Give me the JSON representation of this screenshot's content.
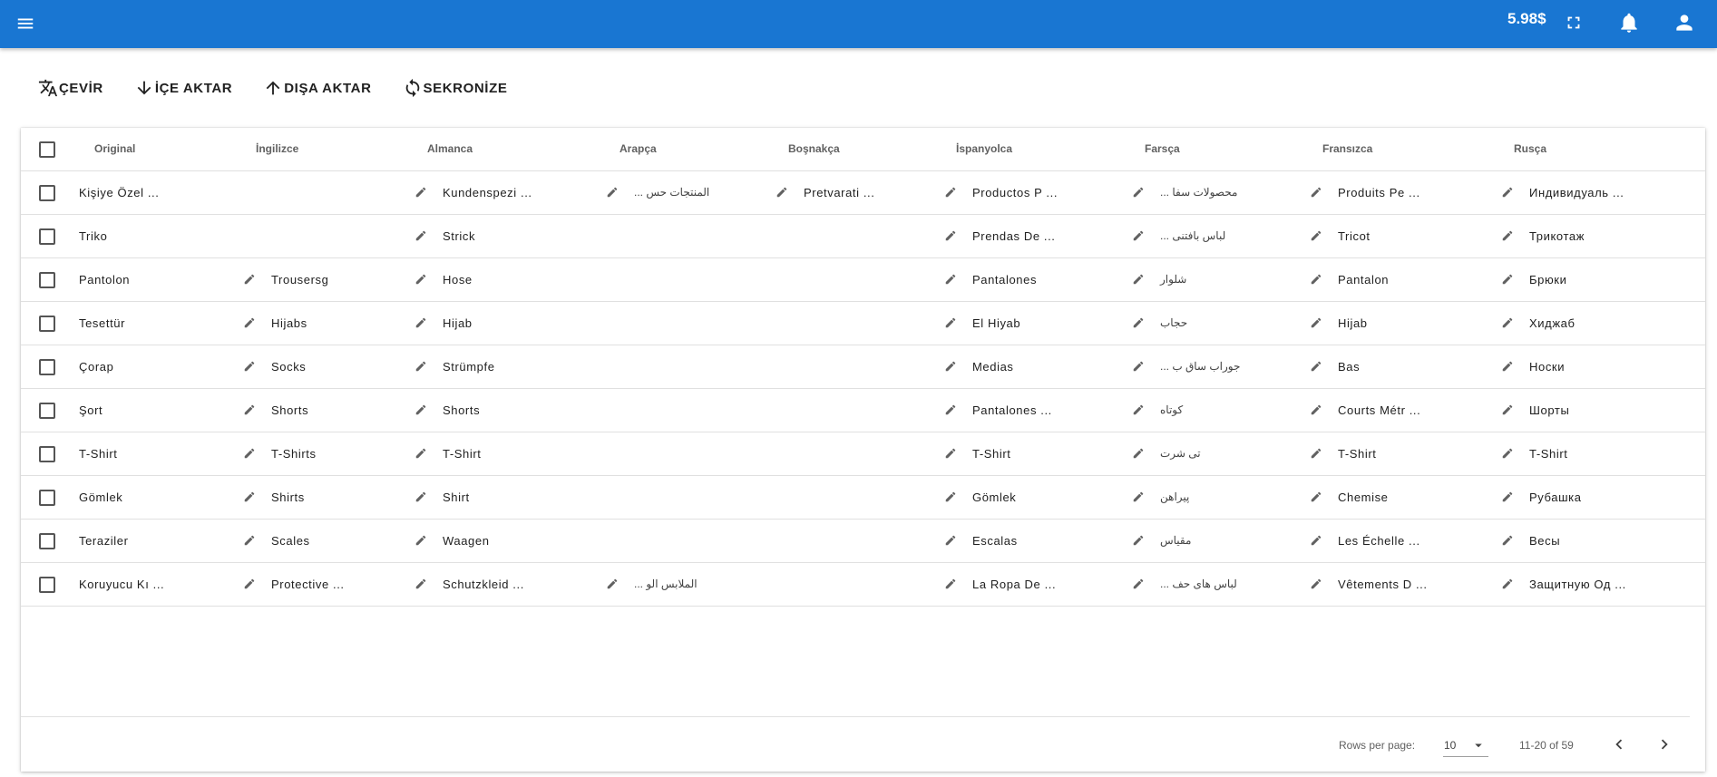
{
  "header": {
    "balance": "5.98$",
    "colors": {
      "appbar": "#1976d2"
    }
  },
  "toolbar": [
    {
      "name": "translate",
      "icon": "translate-icon",
      "label": "ÇEVİR"
    },
    {
      "name": "import",
      "icon": "arrow-down-icon",
      "label": "İÇE AKTAR"
    },
    {
      "name": "export",
      "icon": "arrow-up-icon",
      "label": "DIŞA AKTAR"
    },
    {
      "name": "sync",
      "icon": "sync-icon",
      "label": "SEKRONİZE"
    }
  ],
  "table": {
    "columns": [
      "Original",
      "İngilizce",
      "Almanca",
      "Arapça",
      "Boşnakça",
      "İspanyolca",
      "Farsça",
      "Fransızca",
      "Rusça"
    ],
    "rows": [
      [
        "Kişiye Özel ...",
        "",
        "Kundenspezi ...",
        "المنتجات حس ...",
        "Pretvarati ...",
        "Productos P ...",
        "محصولات سفا ...",
        "Produits Pe ...",
        "Индивидуаль ..."
      ],
      [
        "Triko",
        "",
        "Strick",
        "",
        "",
        "Prendas De ...",
        "لباس بافتنی ...",
        "Tricot",
        "Трикотаж"
      ],
      [
        "Pantolon",
        "Trousersg",
        "Hose",
        "",
        "",
        "Pantalones",
        "شلوار",
        "Pantalon",
        "Брюки"
      ],
      [
        "Tesettür",
        "Hijabs",
        "Hijab",
        "",
        "",
        "El Hiyab",
        "حجاب",
        "Hijab",
        "Хиджаб"
      ],
      [
        "Çorap",
        "Socks",
        "Strümpfe",
        "",
        "",
        "Medias",
        "جوراب ساق ب ...",
        "Bas",
        "Носки"
      ],
      [
        "Şort",
        "Shorts",
        "Shorts",
        "",
        "",
        "Pantalones ...",
        "کوتاه",
        "Courts Métr ...",
        "Шорты"
      ],
      [
        "T-Shirt",
        "T-Shirts",
        "T-Shirt",
        "",
        "",
        "T-Shirt",
        "تی شرت",
        "T-Shirt",
        "T-Shirt"
      ],
      [
        "Gömlek",
        "Shirts",
        "Shirt",
        "",
        "",
        "Gömlek",
        "پیراهن",
        "Chemise",
        "Рубашка"
      ],
      [
        "Teraziler",
        "Scales",
        "Waagen",
        "",
        "",
        "Escalas",
        "مقیاس",
        "Les Échelle ...",
        "Весы"
      ],
      [
        "Koruyucu Kı ...",
        "Protective ...",
        "Schutzkleid ...",
        "الملابس الو ...",
        "",
        "La Ropa De ...",
        "لباس های حف ...",
        "Vêtements D ...",
        "Защитную Од ..."
      ]
    ]
  },
  "pagination": {
    "rows_per_page_label": "Rows per page:",
    "rows_per_page": "10",
    "range": "11-20 of 59"
  }
}
